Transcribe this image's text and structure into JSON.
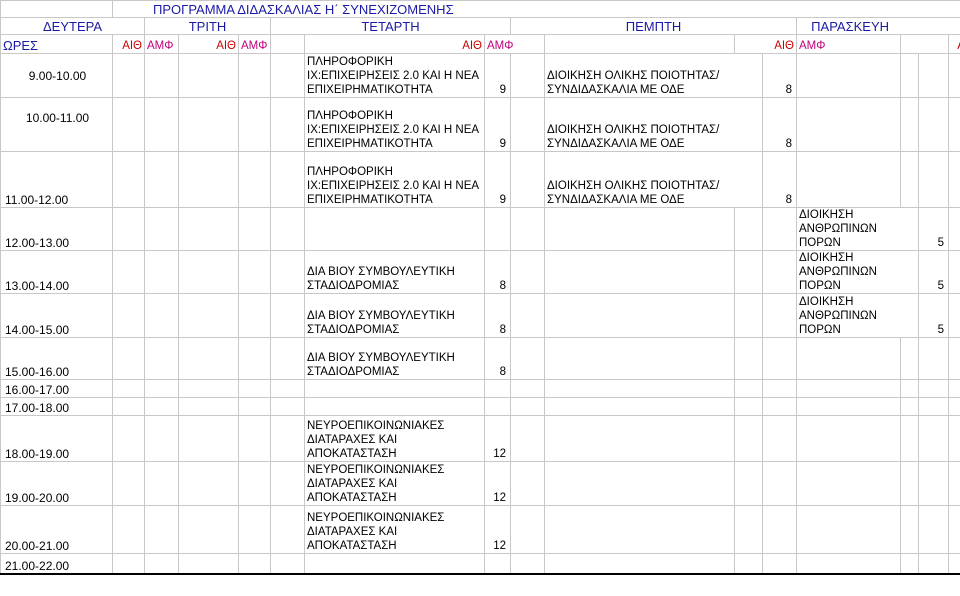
{
  "title": "ΠΡΟΓΡΑΜΜΑ ΔΙΔΑΣΚΑΛΙΑΣ Η΄ ΣΥΝΕΧΙΖΟΜΕΝΗΣ",
  "days": [
    "ΔΕΥΤΕΡΑ",
    "ΤΡΙΤΗ",
    "ΤΕΤΑΡΤΗ",
    "ΠΕΜΠΤΗ",
    "ΠΑΡΑΣΚΕΥΗ"
  ],
  "hours_label": "ΩΡΕΣ",
  "room_aith": "ΑΙΘ",
  "room_amf": "ΑΜΦ",
  "times": [
    "9.00-10.00",
    "10.00-11.00",
    "11.00-12.00",
    "12.00-13.00",
    "13.00-14.00",
    "14.00-15.00",
    "15.00-16.00",
    "16.00-17.00",
    "17.00-18.00",
    "18.00-19.00",
    "19.00-20.00",
    "20.00-21.00",
    "21.00-22.00"
  ],
  "courses": {
    "informatics": "ΠΛΗΡΟΦΟΡΙΚΗ ΙΧ:ΕΠΙΧΕΙΡΗΣΕΙΣ 2.0 ΚΑΙ Η ΝΕΑ ΕΠΙΧΕΙΡΗΜΑΤΙΚΟΤΗΤΑ",
    "informatics_hours": "9",
    "quality": "ΔΙΟΙΚΗΣΗ ΟΛΙΚΗΣ ΠΟΙΟΤΗΤΑΣ/ΣΥΝΔΙΔΑΣΚΑΛΙΑ ΜΕ ΟΔΕ",
    "quality_hours": "8",
    "hr": "ΔΙΟΙΚΗΣΗ ΑΝΘΡΩΠΙΝΩΝ ΠΟΡΩΝ",
    "hr_hours": "5",
    "career": "ΔΙΑ ΒΙΟΥ ΣΥΜΒΟΥΛΕΥΤΙΚΗ ΣΤΑΔΙΟΔΡΟΜΙΑΣ",
    "career_hours": "8",
    "neuro": "ΝΕΥΡΟΕΠΙΚΟΙΝΩΝΙΑΚΕΣ ΔΙΑΤΑΡΑΧΕΣ ΚΑΙ ΑΠΟΚΑΤΑΣΤΑΣΗ",
    "neuro_hours": "12"
  }
}
